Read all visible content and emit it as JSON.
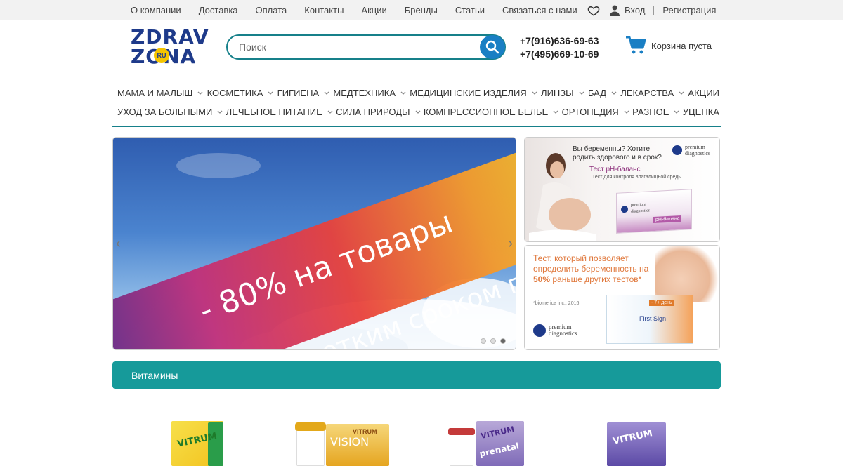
{
  "topnav": {
    "links": [
      "О компании",
      "Доставка",
      "Оплата",
      "Контакты",
      "Акции",
      "Бренды",
      "Статьи",
      "Связаться с нами"
    ],
    "login": "Вход",
    "register": "Регистрация"
  },
  "logo": {
    "line1": "ZDRAV",
    "line2": "ZONA",
    "badge": "RU"
  },
  "search": {
    "placeholder": "Поиск"
  },
  "phones": [
    "+7(916)636-69-63",
    "+7(495)669-10-69"
  ],
  "cart": {
    "label": "Корзина пуста"
  },
  "categories": {
    "row1": [
      "МАМА И МАЛЫШ",
      "КОСМЕТИКА",
      "ГИГИЕНА",
      "МЕДТЕХНИКА",
      "МЕДИЦИНСКИЕ ИЗДЕЛИЯ",
      "ЛИНЗЫ",
      "БАД",
      "ЛЕКАРСТВА",
      "АКЦИИ"
    ],
    "row2": [
      "УХОД ЗА БОЛЬНЫМИ",
      "ЛЕЧЕБНОЕ ПИТАНИЕ",
      "СИЛА ПРИРОДЫ",
      "КОМПРЕССИОННОЕ БЕЛЬЕ",
      "ОРТОПЕДИЯ",
      "РАЗНОЕ",
      "УЦЕНКА"
    ]
  },
  "banner": {
    "line1": "- 80% на товары",
    "line2": "с коротким сроком годности",
    "slides": 3,
    "active_slide": 3
  },
  "ad1": {
    "question": "Вы беременны? Хотите родить здорового и в срок?",
    "title": "Тест pH-баланс",
    "subtitle": "Тест для контроля влагалищной среды",
    "brand_line1": "premium",
    "brand_line2": "diagnostics",
    "box_brand1": "premium",
    "box_brand2": "diagnostics",
    "box_label": "pH-баланс"
  },
  "ad2": {
    "text_before": "Тест, который позволяет определить беременность на ",
    "text_bold": "50%",
    "text_after": " раньше других тестов*",
    "source": "*biomerica inc., 2016",
    "brand_line1": "premium",
    "brand_line2": "diagnostics",
    "box_label": "First Sign",
    "box_tag": "- 7+ день"
  },
  "section": {
    "title": "Витамины"
  },
  "products": [
    {
      "brand": "VITRUM"
    },
    {
      "brand": "VITRUM",
      "sub": "VISION"
    },
    {
      "brand": "VITRUM",
      "sub": "prenatal"
    },
    {
      "brand": "VITRUM"
    }
  ],
  "colors": {
    "accent": "#16808a",
    "section_bg": "#169a9a",
    "search_btn": "#1a7fc4",
    "logo": "#1e3a8a"
  }
}
